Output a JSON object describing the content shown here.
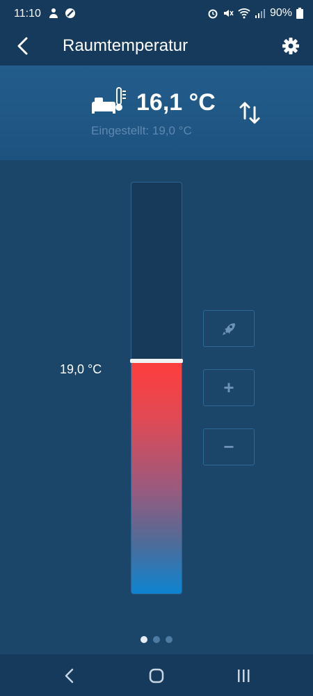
{
  "status_bar": {
    "time": "11:10",
    "battery": "90%",
    "left_icons": [
      "person-icon",
      "blocked-icon"
    ],
    "right_icons": [
      "alarm-icon",
      "mute-icon",
      "wifi-icon",
      "signal-icon",
      "battery-icon"
    ]
  },
  "app_bar": {
    "title": "Raumtemperatur",
    "back_icon": "back-arrow-icon",
    "settings_icon": "gear-icon"
  },
  "header": {
    "icon": "room-thermometer-icon",
    "current_temperature": "16,1 °C",
    "setpoint_text": "Eingestellt: 19,0 °C",
    "switch_icon": "swap-vertical-icon"
  },
  "slider": {
    "value_label": "19,0 °C",
    "fill_fraction": 0.565
  },
  "side_buttons": {
    "boost": {
      "icon": "rocket-icon",
      "label": ""
    },
    "increase": {
      "icon": "plus-icon",
      "label": "+"
    },
    "decrease": {
      "icon": "minus-icon",
      "label": "−"
    }
  },
  "page_indicator": {
    "count": 3,
    "active": 0
  },
  "nav_bar": {
    "icons": [
      "back-icon",
      "home-icon",
      "recent-apps-icon"
    ]
  },
  "colors": {
    "background": "#1b4569",
    "bar": "#163a5c",
    "header_band": "#235d8c",
    "fill_top": "#ff3d3d",
    "fill_bottom": "#0e84d0",
    "muted_text": "#5f88b0"
  }
}
